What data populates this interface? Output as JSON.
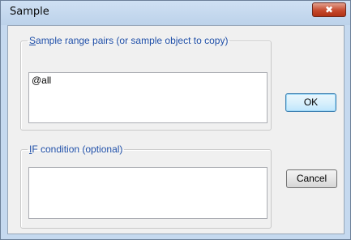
{
  "window": {
    "title": "Sample",
    "close_glyph": "✖"
  },
  "range_group": {
    "label_accel": "S",
    "label_rest": "ample range pairs (or sample object to copy)",
    "value": "@all"
  },
  "condition_group": {
    "label_accel": "I",
    "label_rest": "F condition (optional)",
    "value": ""
  },
  "buttons": {
    "ok": "OK",
    "cancel": "Cancel"
  },
  "colors": {
    "frame": "#c5d9ef",
    "client": "#f0f0f0",
    "group_label": "#1f4fa8",
    "close": "#c64a2e"
  }
}
